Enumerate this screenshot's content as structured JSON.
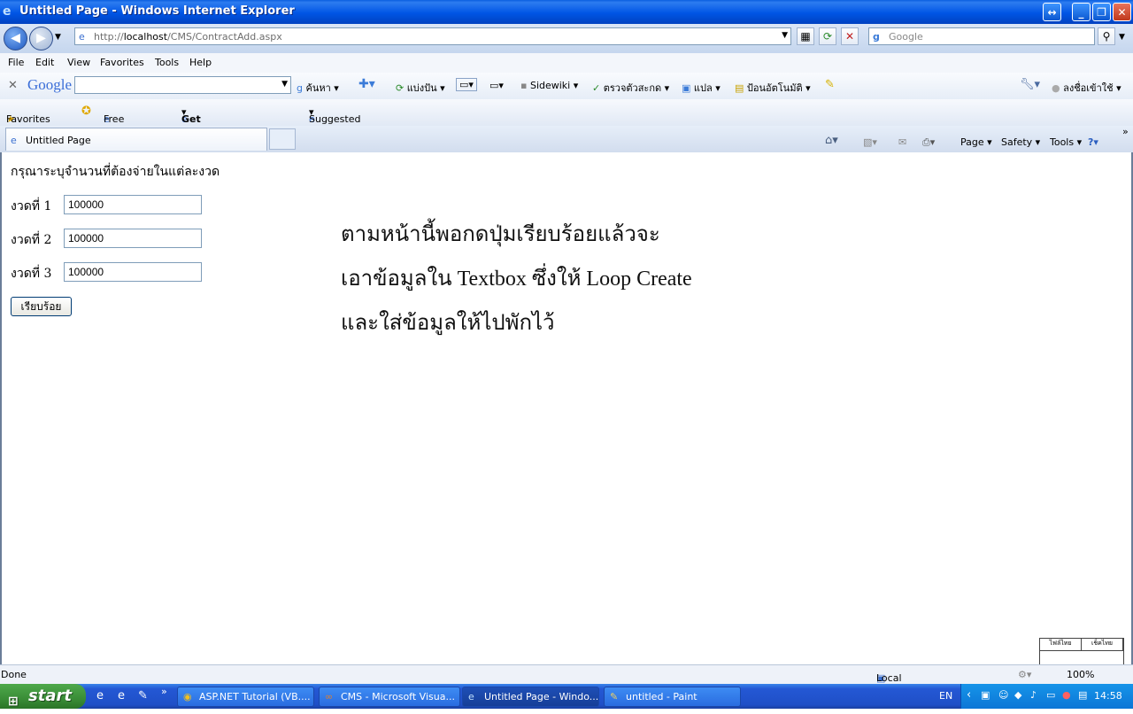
{
  "window": {
    "title": "Untitled Page - Windows Internet Explorer",
    "buttons": [
      "↔",
      "_",
      "❐",
      "✕"
    ]
  },
  "nav": {
    "address": "http://localhost/CMS/ContractAdd.aspx",
    "address_host": "localhost",
    "search_placeholder": "Google"
  },
  "menu": {
    "items": [
      "File",
      "Edit",
      "View",
      "Favorites",
      "Tools",
      "Help"
    ]
  },
  "google_toolbar": {
    "logo": "Google",
    "items": [
      "ค้นหา",
      "แบ่งปัน",
      "Sidewiki",
      "ตรวจตัวสะกด",
      "แปล",
      "ป้อนอัตโนมัติ",
      "ลงชื่อเข้าใช้"
    ]
  },
  "favorites_bar": {
    "items": [
      "Favorites",
      "Free Hotmail",
      "Get More Add-ons",
      "Suggested Sites"
    ]
  },
  "tabs": {
    "active": "Untitled Page"
  },
  "command_bar": {
    "items": [
      "Page",
      "Safety",
      "Tools"
    ]
  },
  "page": {
    "prompt": "กรุณาระบุจำนวนที่ต้องจ่ายในแต่ละงวด",
    "rows": [
      {
        "label": "งวดที่ 1",
        "value": "100000"
      },
      {
        "label": "งวดที่ 2",
        "value": "100000"
      },
      {
        "label": "งวดที่ 3",
        "value": "100000"
      }
    ],
    "submit_label": "เรียบร้อย",
    "note_lines": [
      "ตามหน้านี้พอกดปุ่มเรียบร้อยแล้วจะ",
      "เอาข้อมูลใน Textbox ซึ่งให้ Loop Create",
      "และใส่ข้อมูลให้ไปพักไว้"
    ]
  },
  "status": {
    "left": "Done",
    "zone": "Local intranet",
    "zoom": "100%"
  },
  "taskbar": {
    "start": "start",
    "tasks": [
      "ASP.NET Tutorial (VB....",
      "CMS - Microsoft Visua...",
      "Untitled Page - Windo...",
      "untitled - Paint"
    ],
    "lang": "EN",
    "clock": "14:58"
  },
  "mini_panel": {
    "cells": [
      "ไฟล์ไทย",
      "เช็คไทย"
    ]
  }
}
